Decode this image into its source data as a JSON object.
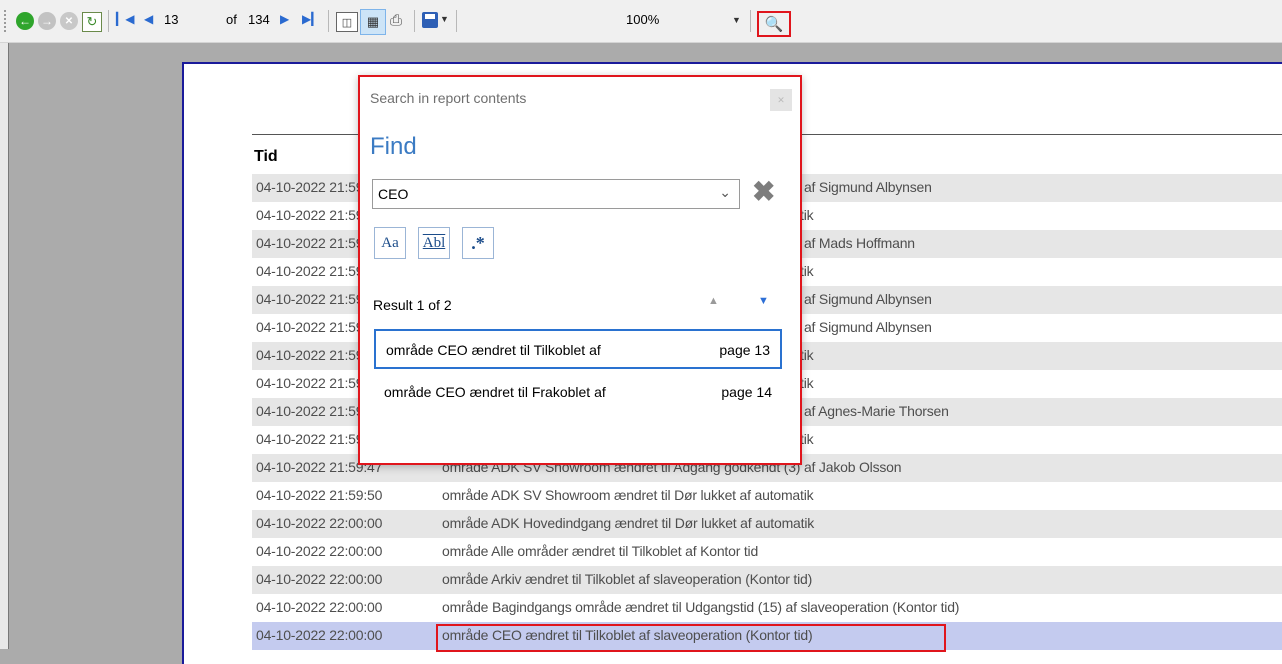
{
  "toolbar": {
    "page_input": "13",
    "page_of": "of",
    "page_total": "134",
    "zoom": "100%"
  },
  "report": {
    "column_header": "Tid",
    "rows": [
      {
        "time": "04-10-2022 21:59:35",
        "desc": "område ADK SV Showroom ændret til Adgang godkendt (3) af Sigmund Albynsen"
      },
      {
        "time": "04-10-2022 21:59:38",
        "desc": "område ADK SV Showroom ændret til Dør lukket af automatik"
      },
      {
        "time": "04-10-2022 21:59:40",
        "desc": "område ADK SV Showroom ændret til Adgang godkendt (3) af Mads Hoffmann"
      },
      {
        "time": "04-10-2022 21:59:42",
        "desc": "område ADK SV Showroom ændret til Dør lukket af automatik"
      },
      {
        "time": "04-10-2022 21:59:43",
        "desc": "område ADK SV Showroom ændret til Adgang godkendt (3) af Sigmund Albynsen"
      },
      {
        "time": "04-10-2022 21:59:44",
        "desc": "område ADK SV Showroom ændret til Adgang godkendt (3) af Sigmund Albynsen"
      },
      {
        "time": "04-10-2022 21:59:45",
        "desc": "område ADK SV Showroom ændret til Dør lukket af automatik"
      },
      {
        "time": "04-10-2022 21:59:45",
        "desc": "område ADK SV Showroom ændret til Dør lukket af automatik"
      },
      {
        "time": "04-10-2022 21:59:46",
        "desc": "område ADK SV Showroom ændret til Adgang godkendt (3) af Agnes-Marie Thorsen"
      },
      {
        "time": "04-10-2022 21:59:46",
        "desc": "område ADK SV Showroom ændret til Dør lukket af automatik"
      },
      {
        "time": "04-10-2022 21:59:47",
        "desc": "område ADK SV Showroom ændret til Adgang godkendt (3) af Jakob Olsson"
      },
      {
        "time": "04-10-2022 21:59:50",
        "desc": "område ADK SV Showroom ændret til Dør lukket af automatik"
      },
      {
        "time": "04-10-2022 22:00:00",
        "desc": "område ADK Hovedindgang ændret til Dør lukket af automatik"
      },
      {
        "time": "04-10-2022 22:00:00",
        "desc": "område Alle områder ændret til Tilkoblet af Kontor tid"
      },
      {
        "time": "04-10-2022 22:00:00",
        "desc": "område Arkiv ændret til Tilkoblet af slaveoperation (Kontor tid)"
      },
      {
        "time": "04-10-2022 22:00:00",
        "desc": "område Bagindgangs område ændret til Udgangstid (15) af slaveoperation (Kontor tid)"
      },
      {
        "time": "04-10-2022 22:00:00",
        "desc": "område CEO ændret til Tilkoblet af slaveoperation (Kontor tid)"
      }
    ]
  },
  "search_popup": {
    "title": "Search in report contents",
    "heading": "Find",
    "query": "CEO",
    "options": [
      "Aa",
      "Abl",
      ".*"
    ],
    "result_label": "Result 1 of 2",
    "results": [
      {
        "text": "område CEO ændret til Tilkoblet af",
        "page": "page 13"
      },
      {
        "text": "område CEO ændret til Frakoblet af",
        "page": "page 14"
      }
    ]
  }
}
